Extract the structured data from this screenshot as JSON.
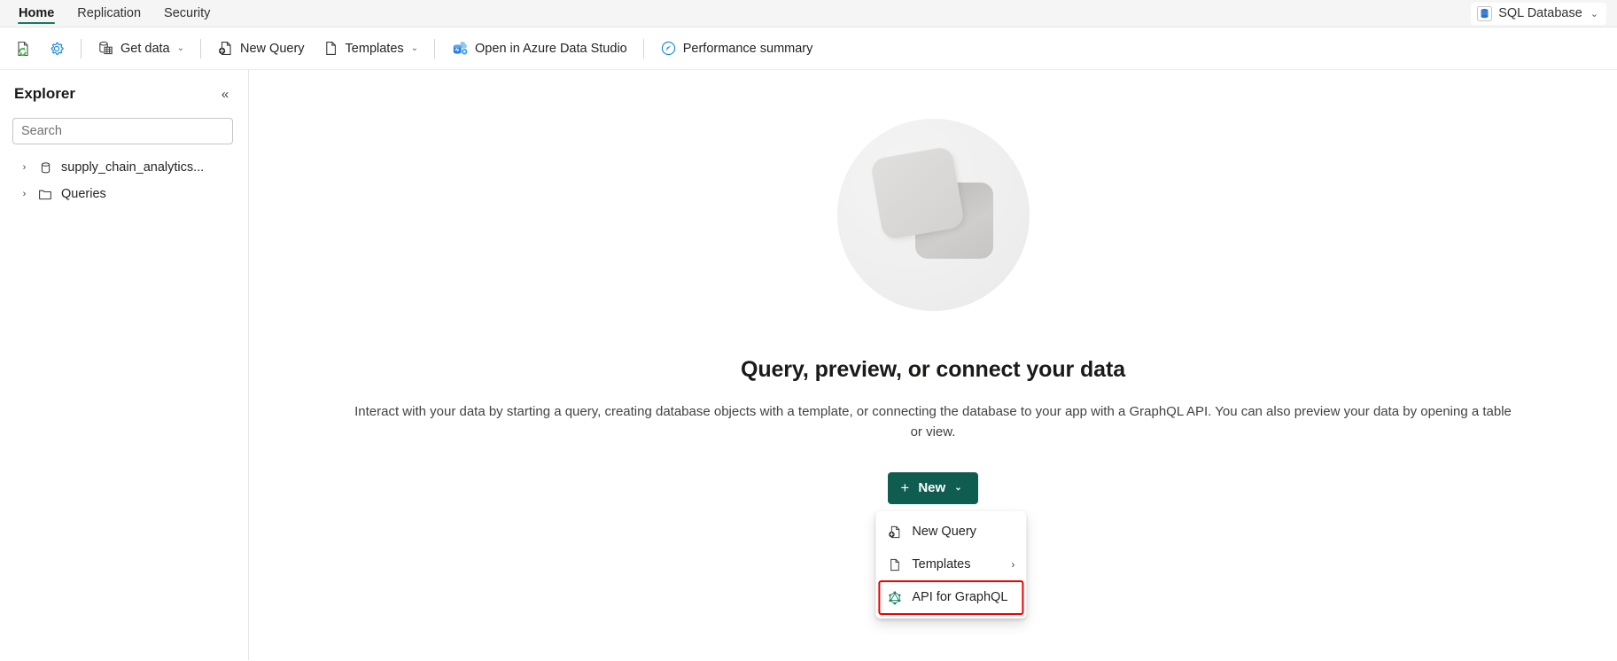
{
  "ribbon": {
    "tabs": [
      {
        "label": "Home",
        "active": true
      },
      {
        "label": "Replication",
        "active": false
      },
      {
        "label": "Security",
        "active": false
      }
    ],
    "context_pill": {
      "label": "SQL Database",
      "icon": "sql-database-icon",
      "chevron": "⌄"
    }
  },
  "toolbar": {
    "refresh": {
      "label": "",
      "icon": "refresh-page-icon"
    },
    "settings": {
      "label": "",
      "icon": "gear-icon"
    },
    "get_data": {
      "label": "Get data",
      "icon": "database-table-icon",
      "chevron": "⌄"
    },
    "new_query": {
      "label": "New Query",
      "icon": "new-query-icon"
    },
    "templates": {
      "label": "Templates",
      "icon": "document-icon",
      "chevron": "⌄"
    },
    "open_ads": {
      "label": "Open in Azure Data Studio",
      "icon": "azure-data-studio-icon"
    },
    "performance_summary": {
      "label": "Performance summary",
      "icon": "gauge-icon"
    }
  },
  "explorer": {
    "title": "Explorer",
    "collapse_icon": "«",
    "search": {
      "placeholder": "Search",
      "value": ""
    },
    "items": [
      {
        "label": "supply_chain_analytics...",
        "icon": "database-icon",
        "arrow": "›"
      },
      {
        "label": "Queries",
        "icon": "folder-icon",
        "arrow": "›"
      }
    ]
  },
  "main": {
    "title": "Query, preview, or connect your data",
    "description": "Interact with your data by starting a query, creating database objects with a template, or connecting the database to your app with a GraphQL API. You can also preview your data by opening a table or view.",
    "illustration": "two-cards-illustration",
    "new_button": {
      "label": "New",
      "plus": "+",
      "chevron": "⌄",
      "color": "#0f5c51"
    },
    "menu": {
      "items": [
        {
          "label": "New Query",
          "icon": "new-query-icon",
          "has_submenu": false,
          "highlighted": false
        },
        {
          "label": "Templates",
          "icon": "document-icon",
          "has_submenu": true,
          "submenu_chevron": "›",
          "highlighted": false
        },
        {
          "label": "API for GraphQL",
          "icon": "graphql-icon",
          "has_submenu": false,
          "highlighted": true
        }
      ]
    }
  },
  "colors": {
    "accent": "#107c61",
    "button": "#0f5c51",
    "highlight": "#ee0000",
    "graphql": "#1a7f64",
    "azure_blue": "#0078d4"
  }
}
